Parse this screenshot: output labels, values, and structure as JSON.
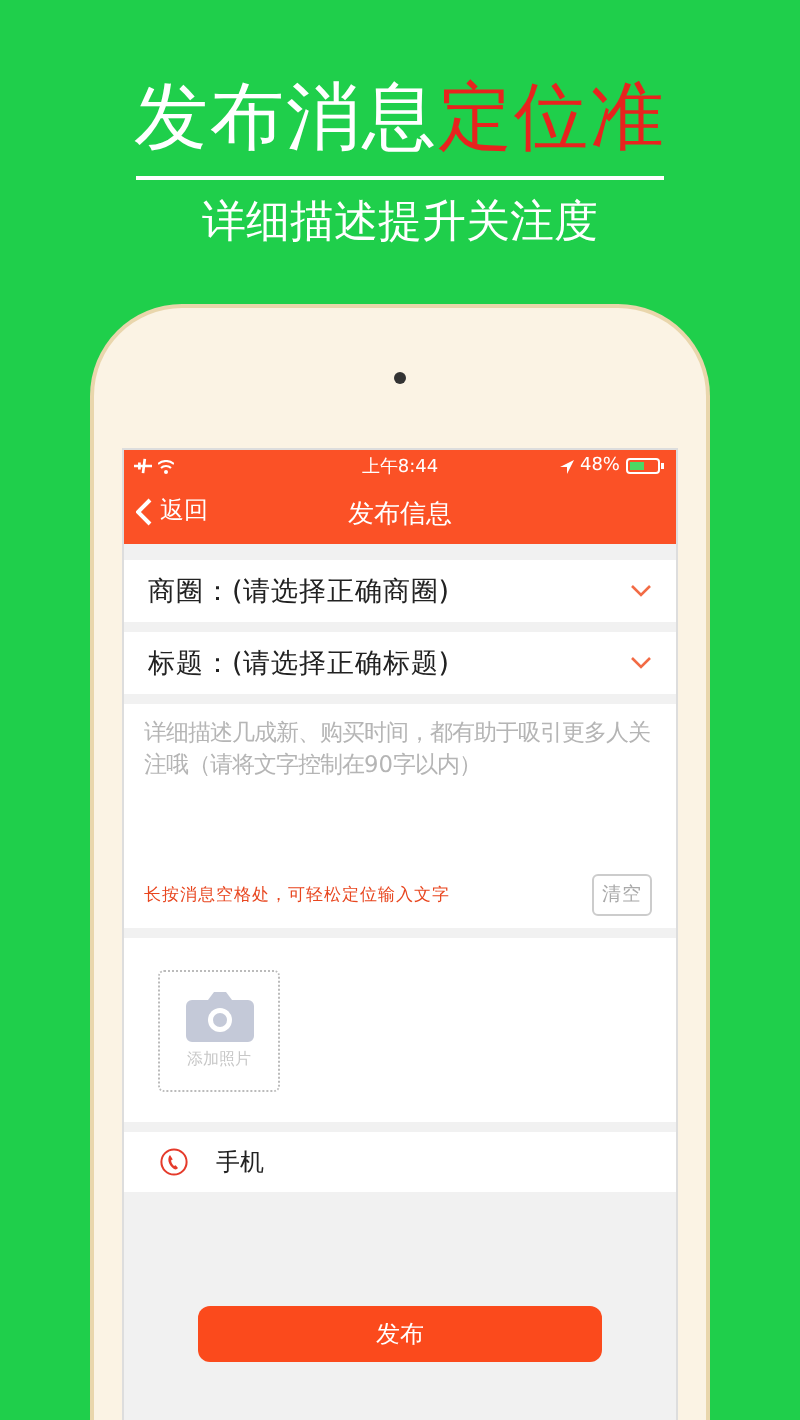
{
  "headline": {
    "text": "发布消息",
    "highlight": "定位准"
  },
  "subtitle": "详细描述提升关注度",
  "status_bar": {
    "time": "上午8:44",
    "battery": "48%"
  },
  "nav": {
    "back": "返回",
    "title": "发布信息"
  },
  "fields": [
    {
      "label": "商圈：(请选择正确商圈)"
    },
    {
      "label": "标题：(请选择正确标题)"
    }
  ],
  "description": {
    "placeholder": "详细描述几成新、购买时间，都有助于吸引更多人关注哦（请将文字控制在90字以内）",
    "hint": "长按消息空格处，可轻松定位输入文字",
    "clear": "清空"
  },
  "photo": {
    "label": "添加照片"
  },
  "contact": {
    "label": "手机"
  },
  "submit": "发布"
}
